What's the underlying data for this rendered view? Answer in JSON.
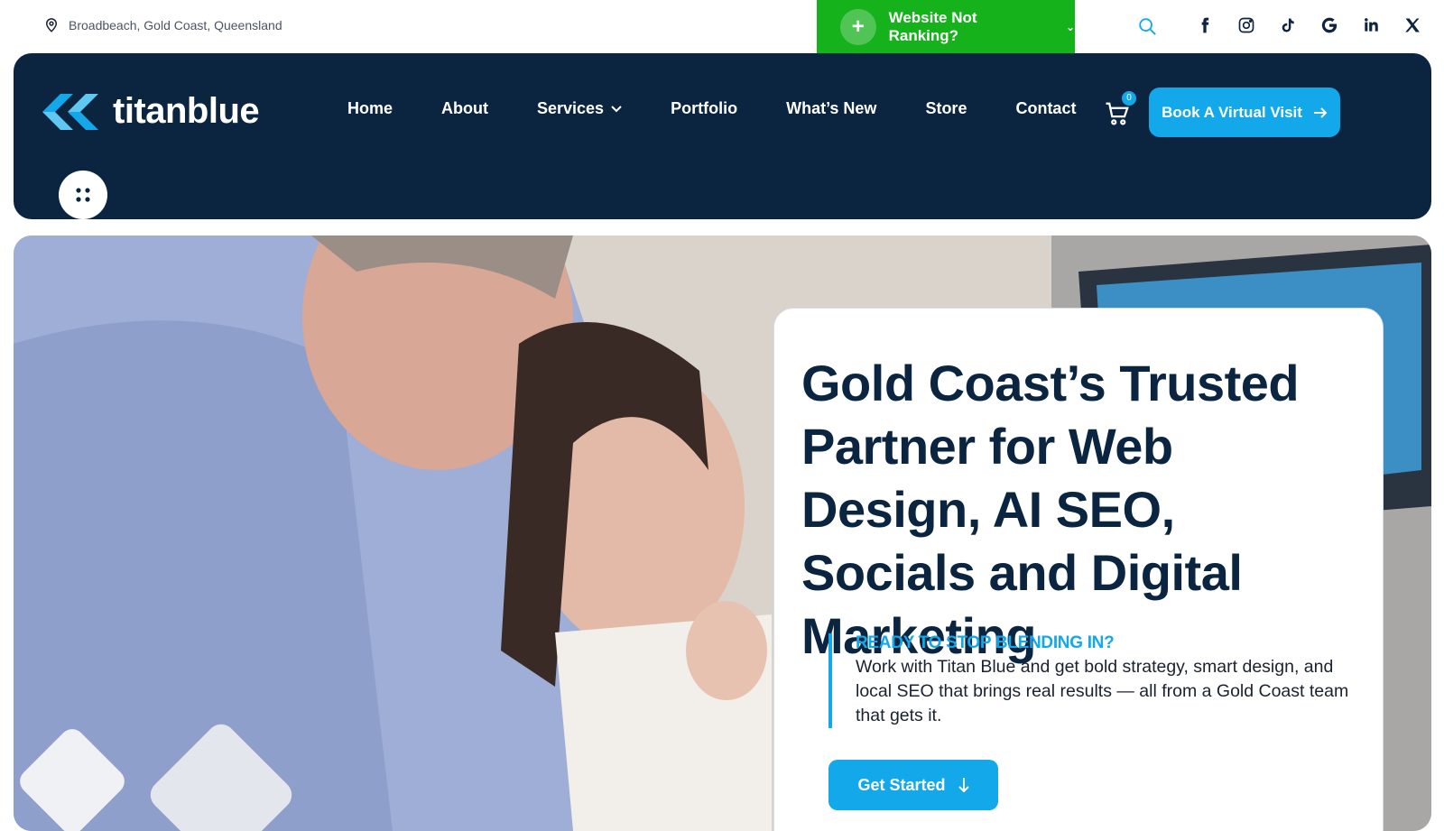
{
  "topbar": {
    "location": "Broadbeach, Gold Coast, Queensland",
    "promo_label": "Website Not Ranking?",
    "socials": [
      "facebook",
      "instagram",
      "tiktok",
      "google",
      "linkedin",
      "x"
    ]
  },
  "header": {
    "logo_text": "titanblue",
    "nav": [
      {
        "label": "Home"
      },
      {
        "label": "About"
      },
      {
        "label": "Services"
      },
      {
        "label": "Portfolio"
      },
      {
        "label": "What’s New"
      },
      {
        "label": "Store"
      },
      {
        "label": "Contact"
      }
    ],
    "cart_count": "0",
    "cta_label": "Book A Virtual Visit"
  },
  "hero": {
    "headline": "Gold Coast’s Trusted Partner for Web Design, AI SEO, Socials and Digital Marketing",
    "kicker": "READY TO STOP BLENDING IN?",
    "body": "Work with Titan Blue and get bold strategy, smart design, and local SEO that brings real results — all from a Gold Coast team that gets it.",
    "button_label": "Get Started"
  },
  "colors": {
    "navy": "#0b2541",
    "accent_blue": "#12a8ea",
    "promo_green": "#16b21c"
  }
}
